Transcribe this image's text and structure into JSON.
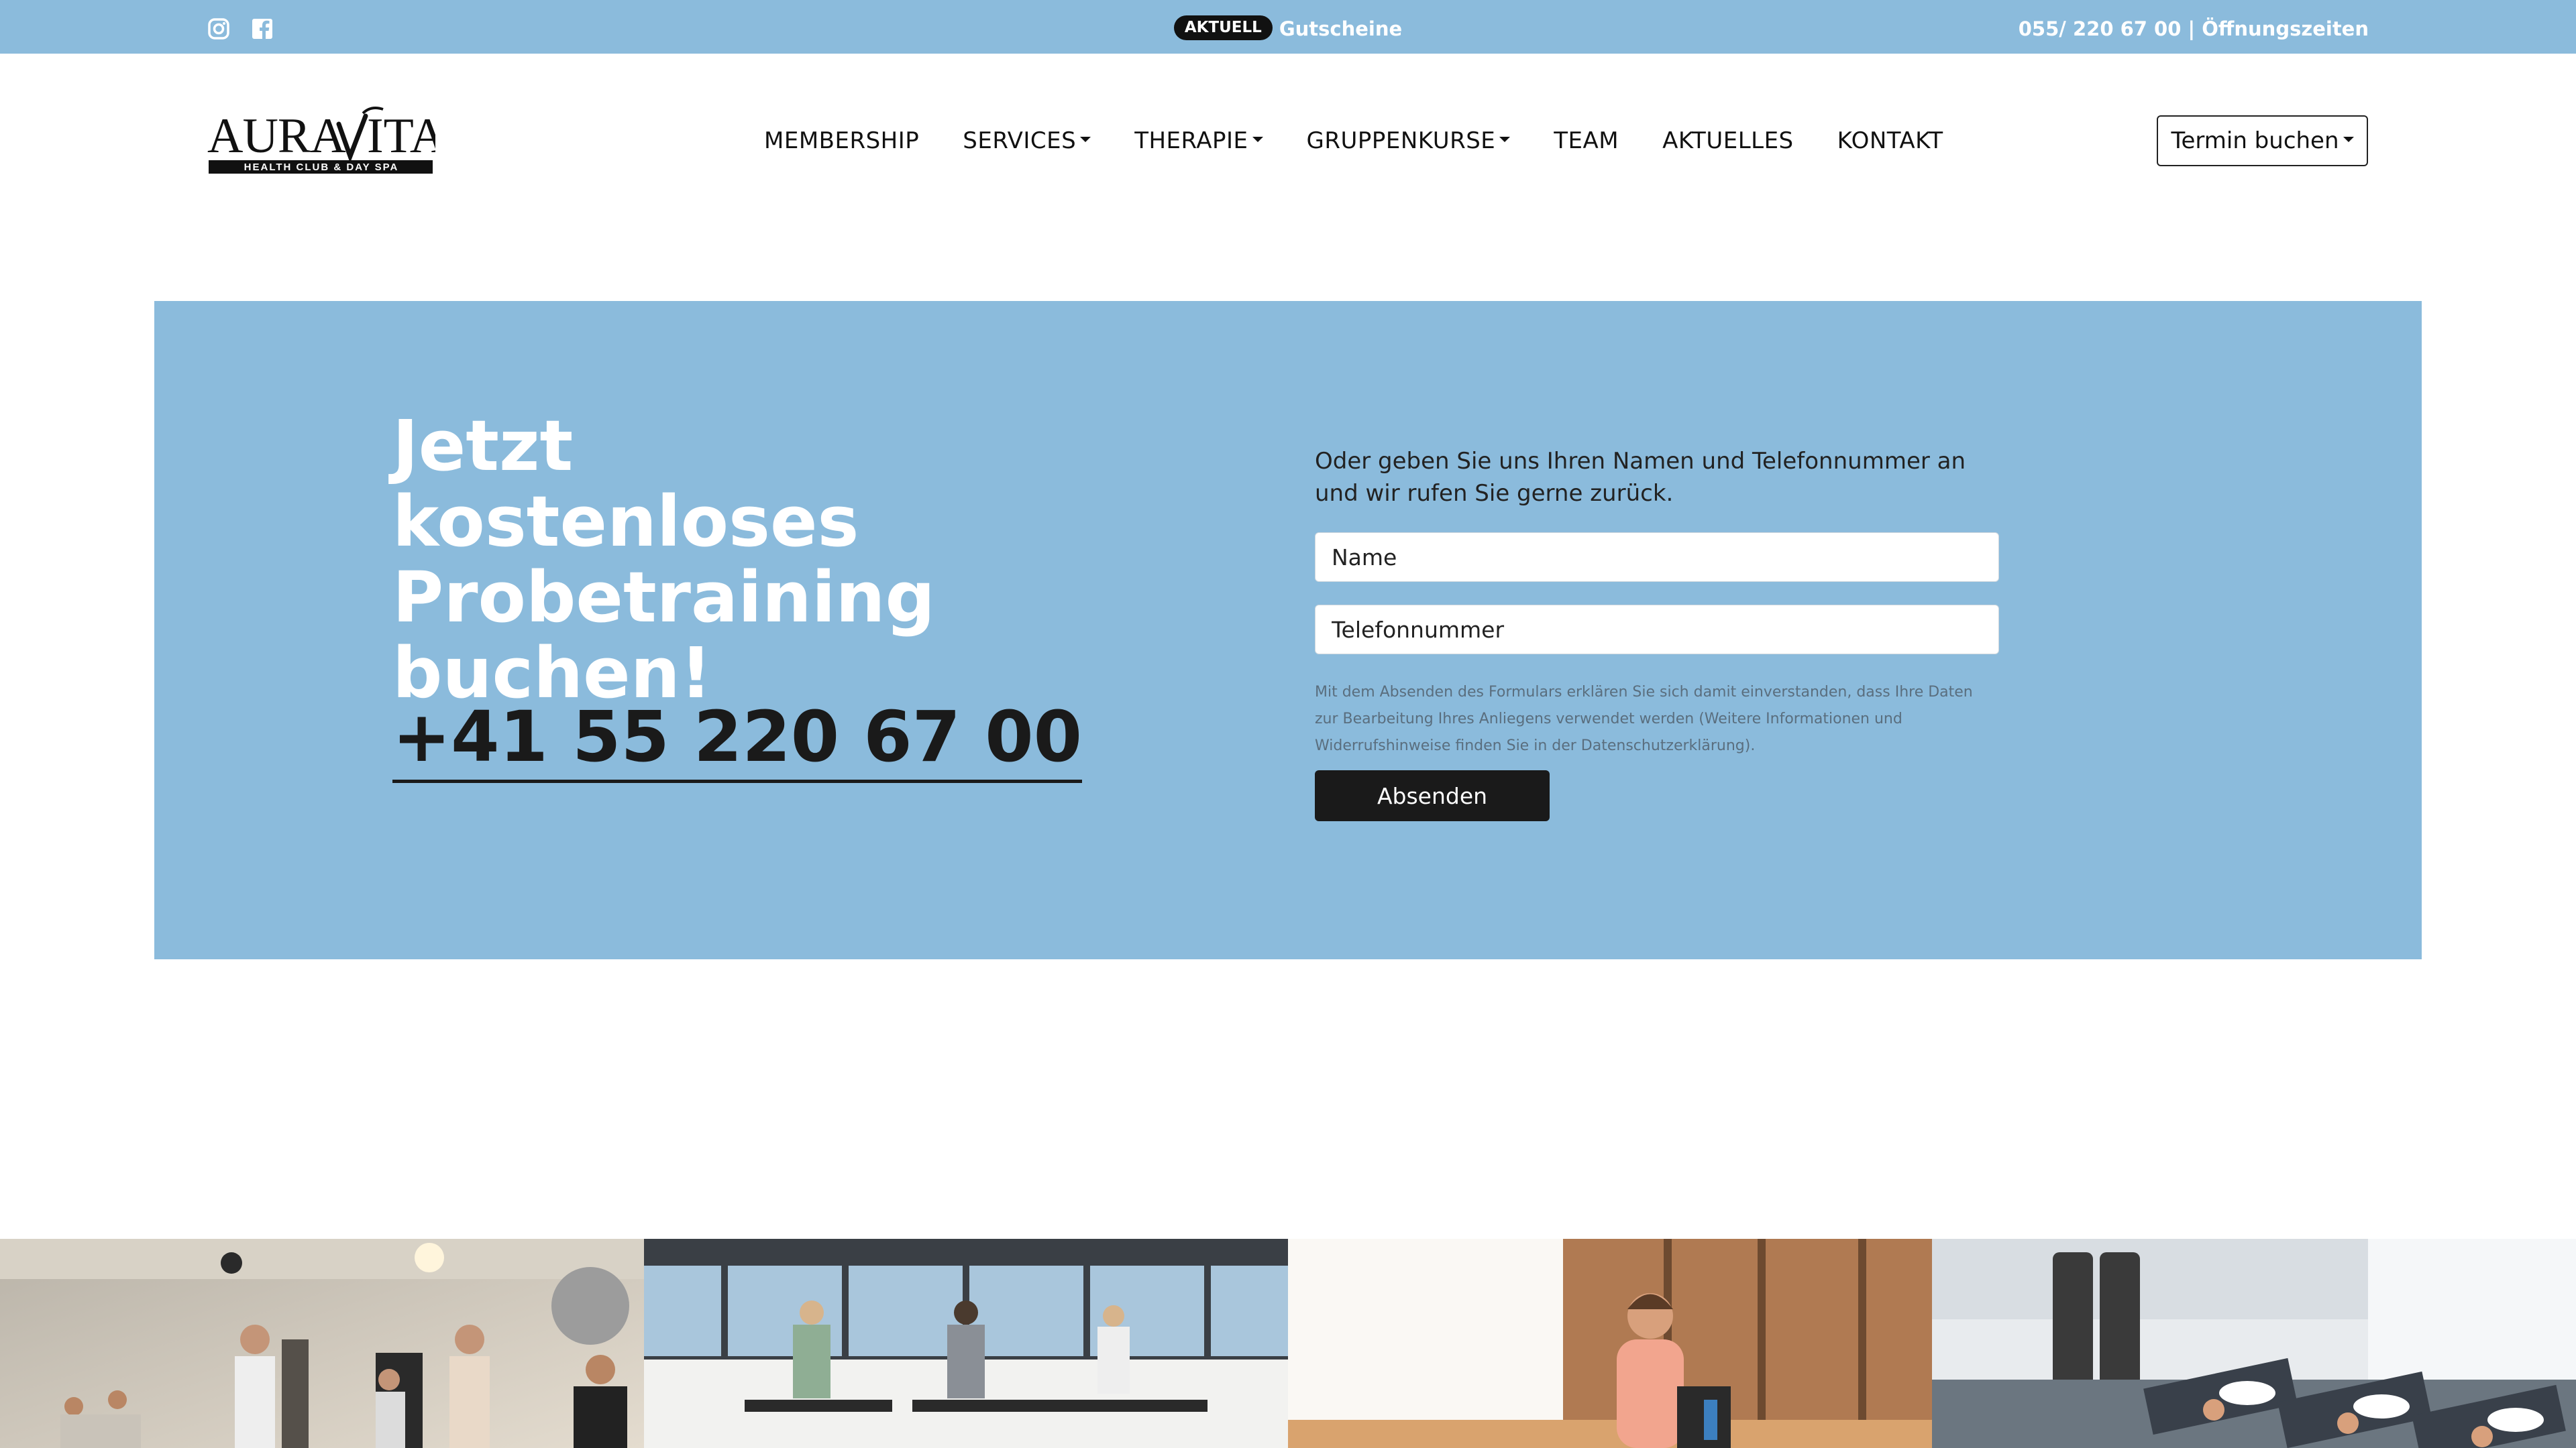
{
  "topbar": {
    "social": [
      {
        "icon": "instagram-icon"
      },
      {
        "icon": "facebook-icon"
      }
    ],
    "badge": "AKTUELL",
    "announcement_link": "Gutscheine",
    "phone": "055/ 220 67 00",
    "separator": "|",
    "hours_link": "Öffnungszeiten"
  },
  "header": {
    "logo_text": "AURAVITA",
    "logo_tagline": "HEALTH CLUB & DAY SPA",
    "nav": [
      {
        "label": "MEMBERSHIP",
        "dropdown": false
      },
      {
        "label": "SERVICES",
        "dropdown": true
      },
      {
        "label": "THERAPIE",
        "dropdown": true
      },
      {
        "label": "GRUPPENKURSE",
        "dropdown": true
      },
      {
        "label": "TEAM",
        "dropdown": false
      },
      {
        "label": "AKTUELLES",
        "dropdown": false
      },
      {
        "label": "KONTAKT",
        "dropdown": false
      }
    ],
    "book_button": "Termin buchen"
  },
  "hero": {
    "title_lines": [
      "Jetzt kostenloses",
      "Probetraining",
      "buchen!"
    ],
    "phone": "+41 55 220 67 00",
    "form": {
      "intro": "Oder geben Sie uns Ihren Namen und Telefonnummer an und wir rufen Sie gerne zurück.",
      "name_placeholder": "Name",
      "phone_placeholder": "Telefonnummer",
      "disclaimer": "Mit dem Absenden des Formulars erklären Sie sich damit einverstanden, dass Ihre Daten zur Bearbeitung Ihres Anliegens verwendet werden (Weitere Informationen und Widerrufshinweise finden Sie in der Datenschutzerklärung).",
      "submit_label": "Absenden"
    }
  },
  "colors": {
    "accent_blue": "#8bbbdc",
    "dark": "#1a1a1a",
    "white": "#ffffff"
  },
  "gallery": [
    {
      "name": "group-fitness-class-photo"
    },
    {
      "name": "treadmill-gym-photo"
    },
    {
      "name": "smiling-woman-photo"
    },
    {
      "name": "yoga-class-photo"
    }
  ]
}
